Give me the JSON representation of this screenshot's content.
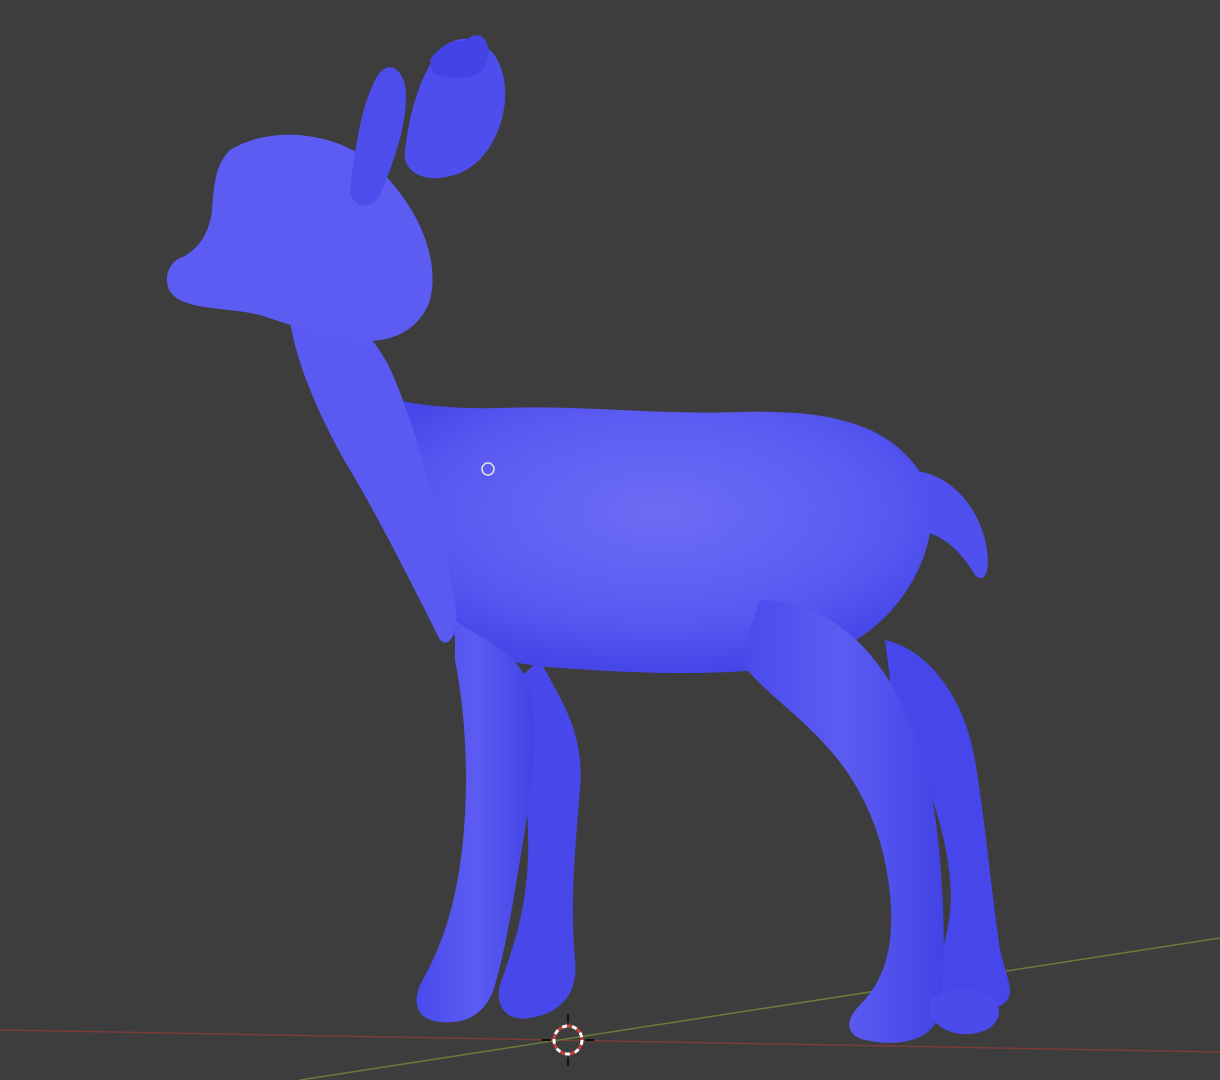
{
  "viewport": {
    "background_color": "#3d3d3d",
    "grid_color": "#444444"
  },
  "object": {
    "icon": "deer-model",
    "color": "#5757f0",
    "shade_color": "#3f3fdd",
    "highlight_color": "#6c6cf5"
  },
  "origin_point": {
    "icon": "object-origin-icon"
  },
  "cursor_3d": {
    "icon": "3d-cursor-icon",
    "ring_colors": [
      "#c8403a",
      "#ffffff"
    ]
  },
  "axes": {
    "x_color": "#7a3b3b",
    "y_color": "#6b7a3a"
  }
}
